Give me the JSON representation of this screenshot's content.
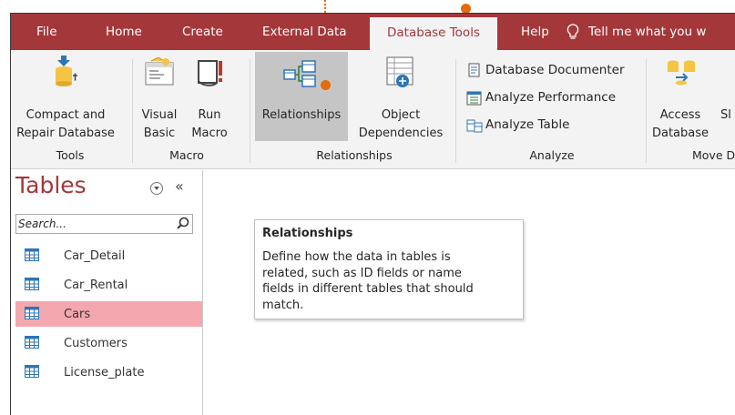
{
  "tabs": [
    {
      "label": "File",
      "active": false
    },
    {
      "label": "Home",
      "active": false
    },
    {
      "label": "Create",
      "active": false
    },
    {
      "label": "External Data",
      "active": false
    },
    {
      "label": "Database Tools",
      "active": true
    },
    {
      "label": "Help",
      "active": false
    }
  ],
  "tell_me": {
    "text": "Tell me what you w",
    "icon": "lightbulb-icon"
  },
  "ribbon": {
    "tools": {
      "label": "Tools",
      "compact": {
        "line1": "Compact and",
        "line2": "Repair Database",
        "icon": "compact-repair-icon"
      }
    },
    "macro": {
      "label": "Macro",
      "visual_basic": {
        "line1": "Visual",
        "line2": "Basic",
        "icon": "visual-basic-icon"
      },
      "run_macro": {
        "line1": "Run",
        "line2": "Macro",
        "icon": "run-macro-icon"
      }
    },
    "relationships": {
      "label": "Relationships",
      "relationships_btn": {
        "line1": "Relationships",
        "icon": "relationships-icon",
        "selected": true
      },
      "object_dependencies": {
        "line1": "Object",
        "line2": "Dependencies",
        "icon": "object-dependencies-icon"
      }
    },
    "analyze": {
      "label": "Analyze",
      "items": [
        "Database Documenter",
        "Analyze Performance",
        "Analyze Table"
      ]
    },
    "move": {
      "label": "Move D",
      "access_db": {
        "line1": "Access",
        "line2": "Database",
        "icon": "access-database-icon"
      },
      "sharepoint": {
        "line1": "Sl"
      }
    }
  },
  "nav": {
    "title": "Tables",
    "collapse_glyph": "«",
    "search_placeholder": "Search...",
    "items": [
      {
        "label": "Car_Detail",
        "selected": false
      },
      {
        "label": "Car_Rental",
        "selected": false
      },
      {
        "label": "Cars",
        "selected": true
      },
      {
        "label": "Customers",
        "selected": false
      },
      {
        "label": "License_plate",
        "selected": false
      }
    ]
  },
  "tooltip": {
    "title": "Relationships",
    "lines": [
      "Define how the data in tables is",
      "related, such as ID fields or name",
      "fields in different tables that should",
      "match."
    ]
  },
  "colors": {
    "accent": "#a4373a",
    "selection": "#f4a7ae",
    "annotation": "#e46c0a"
  }
}
